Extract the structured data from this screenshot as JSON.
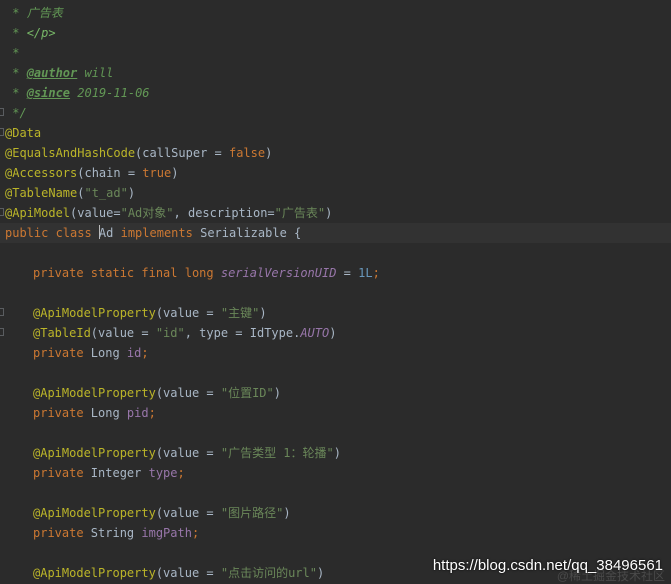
{
  "editor": {
    "lines": [
      {
        "tokens": [
          {
            "t": " * ",
            "c": "c-doc"
          },
          {
            "t": "广告表",
            "c": "c-doc"
          }
        ]
      },
      {
        "tokens": [
          {
            "t": " * ",
            "c": "c-doc"
          },
          {
            "t": "</p>",
            "c": "c-html"
          }
        ]
      },
      {
        "tokens": [
          {
            "t": " *",
            "c": "c-doc"
          }
        ]
      },
      {
        "tokens": [
          {
            "t": " * ",
            "c": "c-doc"
          },
          {
            "t": "@author",
            "c": "c-tag"
          },
          {
            "t": " will",
            "c": "c-doc"
          }
        ]
      },
      {
        "tokens": [
          {
            "t": " * ",
            "c": "c-doc"
          },
          {
            "t": "@since",
            "c": "c-tag"
          },
          {
            "t": " 2019-11-06",
            "c": "c-doc"
          }
        ]
      },
      {
        "fold": true,
        "tokens": [
          {
            "t": " */",
            "c": "c-doc"
          }
        ]
      },
      {
        "fold": true,
        "tokens": [
          {
            "t": "@Data",
            "c": "ann"
          }
        ]
      },
      {
        "tokens": [
          {
            "t": "@EqualsAndHashCode",
            "c": "ann"
          },
          {
            "t": "(callSuper = ",
            "c": "plain"
          },
          {
            "t": "false",
            "c": "kw"
          },
          {
            "t": ")",
            "c": "plain"
          }
        ]
      },
      {
        "tokens": [
          {
            "t": "@Accessors",
            "c": "ann"
          },
          {
            "t": "(chain = ",
            "c": "plain"
          },
          {
            "t": "true",
            "c": "kw"
          },
          {
            "t": ")",
            "c": "plain"
          }
        ]
      },
      {
        "tokens": [
          {
            "t": "@TableName",
            "c": "ann"
          },
          {
            "t": "(",
            "c": "plain"
          },
          {
            "t": "\"t_ad\"",
            "c": "str"
          },
          {
            "t": ")",
            "c": "plain"
          }
        ]
      },
      {
        "fold": true,
        "tokens": [
          {
            "t": "@ApiModel",
            "c": "ann"
          },
          {
            "t": "(value=",
            "c": "plain"
          },
          {
            "t": "\"Ad对象\"",
            "c": "str"
          },
          {
            "t": ", description=",
            "c": "plain"
          },
          {
            "t": "\"广告表\"",
            "c": "str"
          },
          {
            "t": ")",
            "c": "plain"
          }
        ]
      },
      {
        "current": true,
        "tokens": [
          {
            "t": "public class ",
            "c": "kw"
          },
          {
            "caret": true
          },
          {
            "t": "Ad ",
            "c": "plain"
          },
          {
            "t": "implements ",
            "c": "kw"
          },
          {
            "t": "Serializable {",
            "c": "plain"
          }
        ]
      },
      {
        "tokens": []
      },
      {
        "indent": true,
        "tokens": [
          {
            "t": "private static final long ",
            "c": "kw"
          },
          {
            "t": "serialVersionUID",
            "c": "sfld"
          },
          {
            "t": " = ",
            "c": "plain"
          },
          {
            "t": "1L",
            "c": "num"
          },
          {
            "t": ";",
            "c": "kw"
          }
        ]
      },
      {
        "tokens": []
      },
      {
        "fold": true,
        "indent": true,
        "tokens": [
          {
            "t": "@ApiModelProperty",
            "c": "ann"
          },
          {
            "t": "(value = ",
            "c": "plain"
          },
          {
            "t": "\"主键\"",
            "c": "str"
          },
          {
            "t": ")",
            "c": "plain"
          }
        ]
      },
      {
        "fold": true,
        "indent": true,
        "tokens": [
          {
            "t": "@TableId",
            "c": "ann"
          },
          {
            "t": "(value = ",
            "c": "plain"
          },
          {
            "t": "\"id\"",
            "c": "str"
          },
          {
            "t": ", type = IdType.",
            "c": "plain"
          },
          {
            "t": "AUTO",
            "c": "sfld"
          },
          {
            "t": ")",
            "c": "plain"
          }
        ]
      },
      {
        "indent": true,
        "tokens": [
          {
            "t": "private ",
            "c": "kw"
          },
          {
            "t": "Long ",
            "c": "plain"
          },
          {
            "t": "id",
            "c": "fld"
          },
          {
            "t": ";",
            "c": "kw"
          }
        ]
      },
      {
        "tokens": []
      },
      {
        "indent": true,
        "tokens": [
          {
            "t": "@ApiModelProperty",
            "c": "ann"
          },
          {
            "t": "(value = ",
            "c": "plain"
          },
          {
            "t": "\"位置ID\"",
            "c": "str"
          },
          {
            "t": ")",
            "c": "plain"
          }
        ]
      },
      {
        "indent": true,
        "tokens": [
          {
            "t": "private ",
            "c": "kw"
          },
          {
            "t": "Long ",
            "c": "plain"
          },
          {
            "t": "pid",
            "c": "fld"
          },
          {
            "t": ";",
            "c": "kw"
          }
        ]
      },
      {
        "tokens": []
      },
      {
        "indent": true,
        "tokens": [
          {
            "t": "@ApiModelProperty",
            "c": "ann"
          },
          {
            "t": "(value = ",
            "c": "plain"
          },
          {
            "t": "\"广告类型 1：轮播\"",
            "c": "str"
          },
          {
            "t": ")",
            "c": "plain"
          }
        ]
      },
      {
        "indent": true,
        "tokens": [
          {
            "t": "private ",
            "c": "kw"
          },
          {
            "t": "Integer ",
            "c": "plain"
          },
          {
            "t": "type",
            "c": "fld"
          },
          {
            "t": ";",
            "c": "kw"
          }
        ]
      },
      {
        "tokens": []
      },
      {
        "indent": true,
        "tokens": [
          {
            "t": "@ApiModelProperty",
            "c": "ann"
          },
          {
            "t": "(value = ",
            "c": "plain"
          },
          {
            "t": "\"图片路径\"",
            "c": "str"
          },
          {
            "t": ")",
            "c": "plain"
          }
        ]
      },
      {
        "indent": true,
        "tokens": [
          {
            "t": "private ",
            "c": "kw"
          },
          {
            "t": "String ",
            "c": "plain"
          },
          {
            "t": "imgPath",
            "c": "fld"
          },
          {
            "t": ";",
            "c": "kw"
          }
        ]
      },
      {
        "tokens": []
      },
      {
        "indent": true,
        "tokens": [
          {
            "t": "@ApiModelProperty",
            "c": "ann"
          },
          {
            "t": "(value = ",
            "c": "plain"
          },
          {
            "t": "\"点击访问的url\"",
            "c": "str"
          },
          {
            "t": ")",
            "c": "plain"
          }
        ]
      }
    ]
  },
  "watermark": {
    "url": "https://blog.csdn.net/qq_38496561",
    "shadow_text": "@稀土掘金技术社区"
  },
  "colors": {
    "background": "#2b2b2b",
    "current_line": "#323232",
    "keyword": "#cc7832",
    "annotation": "#bbb529",
    "string": "#6a8759",
    "number": "#6897bb",
    "field": "#9876aa",
    "doc_comment": "#629755",
    "text": "#a9b7c6"
  }
}
